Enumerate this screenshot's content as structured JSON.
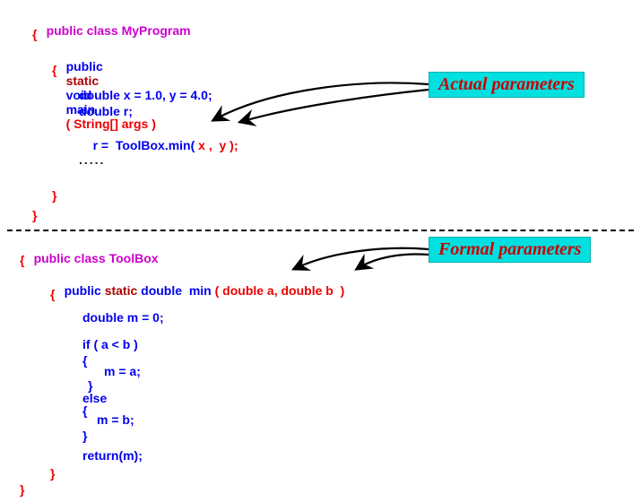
{
  "top": {
    "class_decl": "public class MyProgram",
    "open_brace": "{",
    "main_sig": {
      "public": "public",
      "static": "static",
      "void": "void",
      "main": "main",
      "args": "( String[] args )"
    },
    "body": {
      "decl1": "double x = 1.0, y = 4.0;",
      "decl2": "double r;",
      "call_lhs": "r =  ",
      "call_name": "ToolBox.min(",
      "call_args": " x ,  y );",
      "dots": "....."
    },
    "close_inner": "}",
    "close_outer": "}"
  },
  "bottom": {
    "class_decl": "public class ToolBox",
    "open_brace": "{",
    "min_sig": {
      "public": "public",
      "static": "static",
      "return_type": "double",
      "name": "min",
      "params": "( double a, double b  )"
    },
    "body": {
      "decl": "double m = 0;",
      "if_line": "if ( a < b )",
      "ob1": "{",
      "assign_a": "m = a;",
      "cb1": "}",
      "else_line": "else",
      "ob2": "{",
      "assign_b": "m = b;",
      "cb2": "}",
      "ret": "return(m);"
    },
    "close_inner": "}",
    "close_outer": "}"
  },
  "callouts": {
    "actual": "Actual parameters",
    "formal": "Formal parameters"
  },
  "colors": {
    "magenta": "#cc00cc",
    "blue": "#0000ee",
    "red": "#ee0000",
    "callout_bg": "#00e0e0",
    "callout_fg": "#cc0000"
  }
}
